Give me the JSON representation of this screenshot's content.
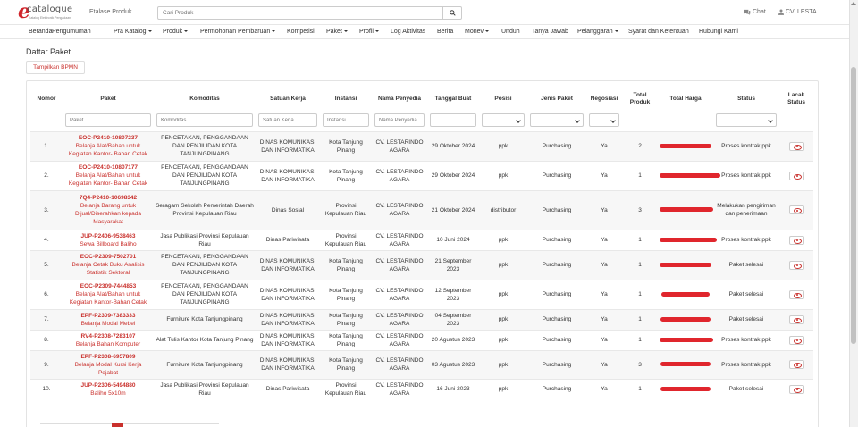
{
  "header": {
    "logo_letter": "e",
    "logo_word": "catalogue",
    "logo_tagline": "Katalog Elektronik Pengadaan",
    "etalase": "Etalase Produk",
    "search_placeholder": "Cari Produk",
    "chat": "Chat",
    "user": "CV. LESTA..."
  },
  "nav": [
    {
      "label": "Beranda",
      "caret": false
    },
    {
      "label": "Pengumuman",
      "caret": false
    },
    {
      "label": "Pra Katalog",
      "caret": true
    },
    {
      "label": "Produk",
      "caret": true
    },
    {
      "label": "Permohonan Pembaruan",
      "caret": true
    },
    {
      "label": "Kompetisi",
      "caret": false
    },
    {
      "label": "Paket",
      "caret": true
    },
    {
      "label": "Profil",
      "caret": true
    },
    {
      "label": "Log Aktivitas",
      "caret": false
    },
    {
      "label": "Berita",
      "caret": false
    },
    {
      "label": "Monev",
      "caret": true
    },
    {
      "label": "Unduh",
      "caret": false
    },
    {
      "label": "Tanya Jawab",
      "caret": false
    },
    {
      "label": "Pelanggaran",
      "caret": true
    },
    {
      "label": "Syarat dan Ketentuan",
      "caret": false
    },
    {
      "label": "Hubungi Kami",
      "caret": false
    }
  ],
  "page": {
    "title": "Daftar Paket",
    "bpmn_button": "Tampilkan BPMN"
  },
  "table": {
    "headers": [
      "Nomor",
      "Paket",
      "Komoditas",
      "Satuan Kerja",
      "Instansi",
      "Nama Penyedia",
      "Tanggal Buat",
      "Posisi",
      "Jenis Paket",
      "Negosiasi",
      "Total Produk",
      "Total Harga",
      "Status",
      "Lacak Status"
    ],
    "filters": {
      "paket": "Paket",
      "komoditas": "Komoditas",
      "satuan_kerja": "Satuan Kerja",
      "instansi": "Instansi",
      "nama_penyedia": "Nama Penyedia"
    },
    "rows": [
      {
        "no": "1.",
        "code": "EOC-P2410-10807237",
        "name": "Belanja Alat/Bahan untuk Kegiatan Kantor- Bahan Cetak",
        "komoditas": "PENCETAKAN, PENGGANDAAN DAN PENJILIDAN KOTA TANJUNGPINANG",
        "satker": "DINAS KOMUNIKASI DAN INFORMATIKA",
        "instansi": "Kota Tanjung Pinang",
        "penyedia": "CV. LESTARINDO AGARA",
        "tanggal": "29 Oktober 2024",
        "posisi": "ppk",
        "jenis": "Purchasing",
        "nego": "Ya",
        "produk": "2",
        "status": "Proses kontrak ppk"
      },
      {
        "no": "2.",
        "code": "EOC-P2410-10807177",
        "name": "Belanja Alat/Bahan untuk Kegiatan Kantor- Bahan Cetak",
        "komoditas": "PENCETAKAN, PENGGANDAAN DAN PENJILIDAN KOTA TANJUNGPINANG",
        "satker": "DINAS KOMUNIKASI DAN INFORMATIKA",
        "instansi": "Kota Tanjung Pinang",
        "penyedia": "CV. LESTARINDO AGARA",
        "tanggal": "29 Oktober 2024",
        "posisi": "ppk",
        "jenis": "Purchasing",
        "nego": "Ya",
        "produk": "1",
        "status": "Proses kontrak ppk"
      },
      {
        "no": "3.",
        "code": "7Q4-P2410-10698342",
        "name": "Belanja Barang untuk Dijual/Diserahkan kepada Masyarakat",
        "komoditas": "Seragam Sekolah Pemerintah Daerah Provinsi Kepulauan Riau",
        "satker": "Dinas Sosial",
        "instansi": "Provinsi Kepulauan Riau",
        "penyedia": "CV. LESTARINDO AGARA",
        "tanggal": "21 Oktober 2024",
        "posisi": "distributor",
        "jenis": "Purchasing",
        "nego": "Ya",
        "produk": "3",
        "status": "Melakukan pengiriman dan penerimaan"
      },
      {
        "no": "4.",
        "code": "JUP-P2406-9538463",
        "name": "Sewa Billboard Baliho",
        "komoditas": "Jasa Publikasi Provinsi Kepulauan Riau",
        "satker": "Dinas Pariwisata",
        "instansi": "Provinsi Kepulauan Riau",
        "penyedia": "CV. LESTARINDO AGARA",
        "tanggal": "10 Juni 2024",
        "posisi": "ppk",
        "jenis": "Purchasing",
        "nego": "Ya",
        "produk": "1",
        "status": "Proses kontrak ppk"
      },
      {
        "no": "5.",
        "code": "EOC-P2309-7502701",
        "name": "Belanja Cetak Buku Analisis Statistik Sektoral",
        "komoditas": "PENCETAKAN, PENGGANDAAN DAN PENJILIDAN KOTA TANJUNGPINANG",
        "satker": "DINAS KOMUNIKASI DAN INFORMATIKA",
        "instansi": "Kota Tanjung Pinang",
        "penyedia": "CV. LESTARINDO AGARA",
        "tanggal": "21 September 2023",
        "posisi": "ppk",
        "jenis": "Purchasing",
        "nego": "Ya",
        "produk": "1",
        "status": "Paket selesai"
      },
      {
        "no": "6.",
        "code": "EOC-P2309-7444853",
        "name": "Belanja Alat/Bahan untuk Kegiatan Kantor-Bahan Cetak",
        "komoditas": "PENCETAKAN, PENGGANDAAN DAN PENJILIDAN KOTA TANJUNGPINANG",
        "satker": "DINAS KOMUNIKASI DAN INFORMATIKA",
        "instansi": "Kota Tanjung Pinang",
        "penyedia": "CV. LESTARINDO AGARA",
        "tanggal": "12 September 2023",
        "posisi": "ppk",
        "jenis": "Purchasing",
        "nego": "Ya",
        "produk": "1",
        "status": "Paket selesai"
      },
      {
        "no": "7.",
        "code": "EPF-P2309-7383333",
        "name": "Belanja Modal Mebel",
        "komoditas": "Furniture Kota Tanjungpinang",
        "satker": "DINAS KOMUNIKASI DAN INFORMATIKA",
        "instansi": "Kota Tanjung Pinang",
        "penyedia": "CV. LESTARINDO AGARA",
        "tanggal": "04 September 2023",
        "posisi": "ppk",
        "jenis": "Purchasing",
        "nego": "Ya",
        "produk": "1",
        "status": "Paket selesai"
      },
      {
        "no": "8.",
        "code": "RV4-P2308-7283107",
        "name": "Belanja Bahan Komputer",
        "komoditas": "Alat Tulis Kantor Kota Tanjung Pinang",
        "satker": "DINAS KOMUNIKASI DAN INFORMATIKA",
        "instansi": "Kota Tanjung Pinang",
        "penyedia": "CV. LESTARINDO AGARA",
        "tanggal": "20 Agustus 2023",
        "posisi": "ppk",
        "jenis": "Purchasing",
        "nego": "Ya",
        "produk": "1",
        "status": "Proses kontrak ppk"
      },
      {
        "no": "9.",
        "code": "EPF-P2308-6957809",
        "name": "Belanja Modal Kursi Kerja Pejabat",
        "komoditas": "Furniture Kota Tanjungpinang",
        "satker": "DINAS KOMUNIKASI DAN INFORMATIKA",
        "instansi": "Kota Tanjung Pinang",
        "penyedia": "CV. LESTARINDO AGARA",
        "tanggal": "03 Agustus 2023",
        "posisi": "ppk",
        "jenis": "Purchasing",
        "nego": "Ya",
        "produk": "3",
        "status": "Proses kontrak ppk"
      },
      {
        "no": "10.",
        "code": "JUP-P2306-5494880",
        "name": "Baliho 5x10m",
        "komoditas": "Jasa Publikasi Provinsi Kepulauan Riau",
        "satker": "Dinas Pariwisata",
        "instansi": "Provinsi Kepulauan Riau",
        "penyedia": "CV. LESTARINDO AGARA",
        "tanggal": "16 Juni 2023",
        "posisi": "ppk",
        "jenis": "Purchasing",
        "nego": "Ya",
        "produk": "1",
        "status": "Paket selesai"
      }
    ]
  },
  "colors": {
    "accent": "#c9302c",
    "redaction": "#e0262d"
  }
}
